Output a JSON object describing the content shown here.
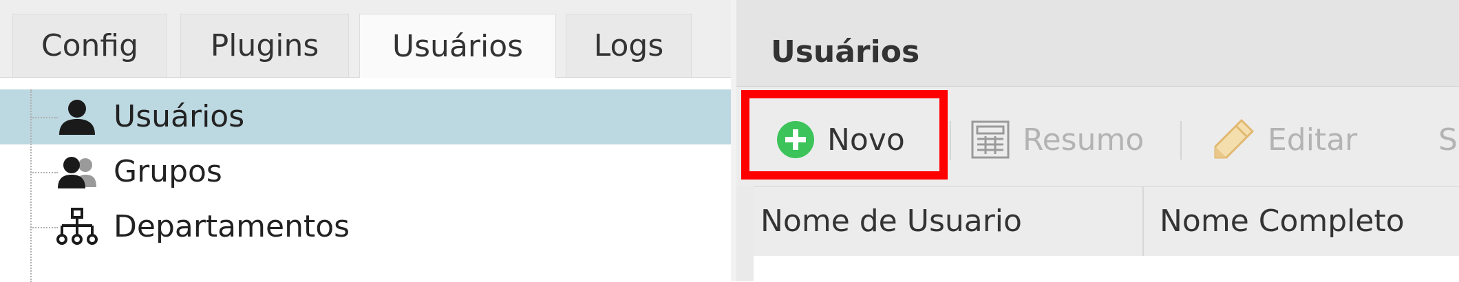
{
  "left": {
    "tabs": [
      {
        "label": "Config",
        "active": false
      },
      {
        "label": "Plugins",
        "active": false
      },
      {
        "label": "Usuários",
        "active": true
      },
      {
        "label": "Logs",
        "active": false
      }
    ],
    "tree": [
      {
        "label": "Usuários",
        "icon": "user-icon",
        "selected": true
      },
      {
        "label": "Grupos",
        "icon": "users-group-icon",
        "selected": false
      },
      {
        "label": "Departamentos",
        "icon": "org-chart-icon",
        "selected": false
      }
    ]
  },
  "right": {
    "title": "Usuários",
    "toolbar": {
      "novo": "Novo",
      "resumo": "Resumo",
      "editar": "Editar",
      "more": "S"
    },
    "columns": [
      "Nome de Usuario",
      "Nome Completo"
    ]
  },
  "colors": {
    "selected_row": "#bcd8e1",
    "add_icon": "#3cc35a",
    "highlight": "#ff0000",
    "disabled_text": "#b3b3b3"
  }
}
